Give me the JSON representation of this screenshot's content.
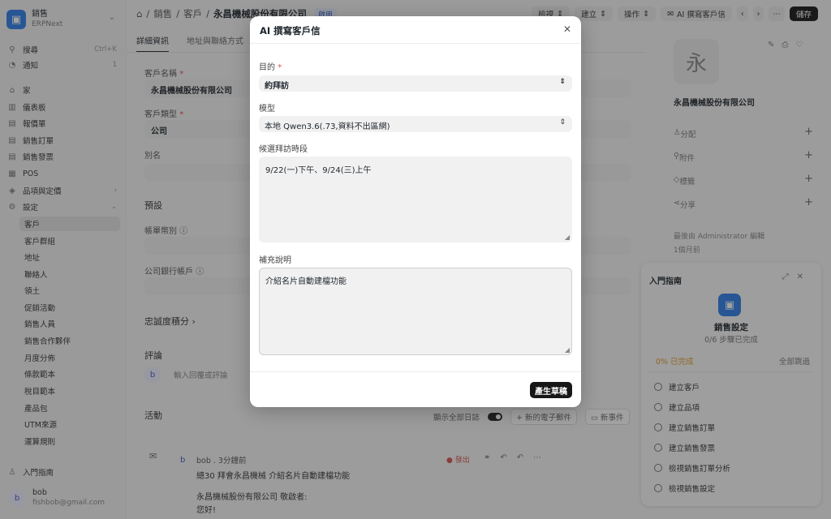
{
  "app": {
    "title": "銷售",
    "subtitle": "ERPNext"
  },
  "sidebar": {
    "search": {
      "label": "搜尋",
      "shortcut": "Ctrl+K"
    },
    "notifications": {
      "label": "通知",
      "count": "1"
    },
    "items": [
      {
        "label": "家",
        "icon": "home-icon"
      },
      {
        "label": "儀表板",
        "icon": "chart-icon"
      },
      {
        "label": "報價單",
        "icon": "doc-icon"
      },
      {
        "label": "銷售訂單",
        "icon": "doc-icon"
      },
      {
        "label": "銷售發票",
        "icon": "doc-icon"
      },
      {
        "label": "POS",
        "icon": "pos-icon"
      },
      {
        "label": "品項與定價",
        "icon": "box-icon"
      },
      {
        "label": "設定",
        "icon": "gear-icon"
      }
    ],
    "sub_items": [
      "客戶",
      "客戶群組",
      "地址",
      "聯絡人",
      "領土",
      "促銷活動",
      "銷售人員",
      "銷售合作夥伴",
      "月度分佈",
      "條款範本",
      "稅目範本",
      "產品包",
      "UTM來源",
      "運算規則"
    ],
    "guide_label": "入門指南",
    "user": {
      "initial": "b",
      "name": "bob",
      "email": "fishbob@gmail.com"
    }
  },
  "header": {
    "breadcrumb": [
      "銷售",
      "客戶",
      "永昌機械股份有限公司"
    ],
    "tag": "啟用",
    "buttons": {
      "view": "檢視",
      "create": "建立",
      "actions": "操作",
      "ai": "AI 撰寫客戶信",
      "save": "儲存"
    }
  },
  "tabs": [
    "詳細資訊",
    "地址與聯絡方式"
  ],
  "form": {
    "customer_name_label": "客戶名稱",
    "customer_name": "永昌機械股份有限公司",
    "customer_type_label": "客戶類型",
    "customer_type": "公司",
    "alias_label": "別名",
    "default_label": "預設",
    "currency_label": "帳單幣別",
    "bank_label": "公司銀行帳戶",
    "loyalty_label": "忠誠度積分",
    "comment_title": "評論",
    "comment_initial": "b",
    "comment_placeholder": "輸入回覆或評論"
  },
  "activity": {
    "title": "活動",
    "show_all": "顯示全部日誌",
    "new_email": "新的電子郵件",
    "new_event": "新事件",
    "entry": {
      "initial": "b",
      "meta": "bob . 3分鐘前",
      "status": "● 發出",
      "subject": "總30 拜會永昌機械 介紹名片自動建檔功能",
      "body1": "永昌機械股份有限公司 敬啟者:",
      "body2": "您好!"
    }
  },
  "right": {
    "avatar_char": "永",
    "name": "永昌機械股份有限公司",
    "rows": [
      "分配",
      "附件",
      "標籤",
      "分享"
    ],
    "edited_by": "最後由 Administrator 編輯",
    "edited_when": "1個月前"
  },
  "guide": {
    "title": "入門指南",
    "card_title": "銷售設定",
    "progress_text": "0/6 步驟已完成",
    "percent": "0% 已完成",
    "skip": "全部跳過",
    "steps": [
      "建立客戶",
      "建立品項",
      "建立銷售訂單",
      "建立銷售發票",
      "檢視銷售訂單分析",
      "檢視銷售設定"
    ]
  },
  "modal": {
    "title": "AI 撰寫客戶信",
    "purpose_label": "目的",
    "purpose_value": "約拜訪",
    "model_label": "模型",
    "model_value": "本地 Qwen3.6(.73,資料不出區網)",
    "slots_label": "候選拜訪時段",
    "slots_value": "9/22(一)下午、9/24(三)上午",
    "notes_label": "補充說明",
    "notes_value": "介紹名片自動建檔功能",
    "generate": "產生草稿"
  },
  "colors": {
    "accent": "#2f7ee8",
    "dark_button": "#171717",
    "required": "#e24c4c"
  }
}
